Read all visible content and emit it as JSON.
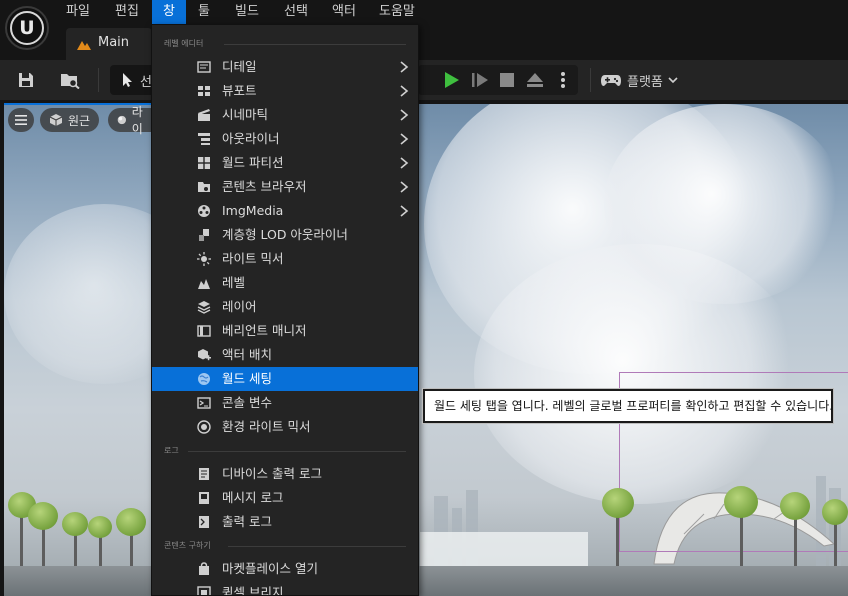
{
  "menubar": {
    "logo_text": "U",
    "items": [
      {
        "label": "파일"
      },
      {
        "label": "편집"
      },
      {
        "label": "창"
      },
      {
        "label": "툴"
      },
      {
        "label": "빌드"
      },
      {
        "label": "선택"
      },
      {
        "label": "액터"
      },
      {
        "label": "도움말"
      }
    ],
    "active_index": 2
  },
  "tab": {
    "label": "Main"
  },
  "toolbar": {
    "mode_label": "선",
    "platforms_label": "플랫폼"
  },
  "viewport": {
    "perspective_label": "원근",
    "lit_label": "라이"
  },
  "window_menu": {
    "sections": [
      {
        "label": "레벨 에디터"
      },
      {
        "label": "로그"
      },
      {
        "label": "콘텐츠 구하기"
      }
    ],
    "items": [
      {
        "label": "디테일",
        "icon": "details-icon",
        "submenu": true
      },
      {
        "label": "뷰포트",
        "icon": "viewports-icon",
        "submenu": true
      },
      {
        "label": "시네마틱",
        "icon": "cinematics-icon",
        "submenu": true
      },
      {
        "label": "아웃라이너",
        "icon": "outliner-icon",
        "submenu": true
      },
      {
        "label": "월드 파티션",
        "icon": "world-partition-icon",
        "submenu": true
      },
      {
        "label": "콘텐츠 브라우저",
        "icon": "content-browser-icon",
        "submenu": true
      },
      {
        "label": "ImgMedia",
        "icon": "imgmedia-icon",
        "submenu": true
      },
      {
        "label": "계층형 LOD 아웃라이너",
        "icon": "hlod-outliner-icon",
        "submenu": false
      },
      {
        "label": "라이트 믹서",
        "icon": "light-mixer-icon",
        "submenu": false
      },
      {
        "label": "레벨",
        "icon": "levels-icon",
        "submenu": false
      },
      {
        "label": "레이어",
        "icon": "layers-icon",
        "submenu": false
      },
      {
        "label": "베리언트 매니저",
        "icon": "variant-manager-icon",
        "submenu": false
      },
      {
        "label": "액터 배치",
        "icon": "place-actors-icon",
        "submenu": false
      },
      {
        "label": "월드 세팅",
        "icon": "world-settings-icon",
        "submenu": false
      },
      {
        "label": "콘솔 변수",
        "icon": "console-variables-icon",
        "submenu": false
      },
      {
        "label": "환경 라이트 믹서",
        "icon": "env-light-mixer-icon",
        "submenu": false
      },
      {
        "label": "디바이스 출력 로그",
        "icon": "device-output-log-icon",
        "submenu": false
      },
      {
        "label": "메시지 로그",
        "icon": "message-log-icon",
        "submenu": false
      },
      {
        "label": "출력 로그",
        "icon": "output-log-icon",
        "submenu": false
      },
      {
        "label": "마켓플레이스 열기",
        "icon": "marketplace-icon",
        "submenu": false
      },
      {
        "label": "퀵셀 브리지",
        "icon": "quixel-bridge-icon",
        "submenu": false
      }
    ],
    "highlighted_index": 13
  },
  "tooltip": {
    "text": "월드 세팅 탭을 엽니다. 레벨의 글로벌 프로퍼티를 확인하고 편집할 수 있습니다."
  },
  "colors": {
    "accent": "#0870d8",
    "menu_bg": "#242424",
    "play_green": "#3fbf3f"
  }
}
